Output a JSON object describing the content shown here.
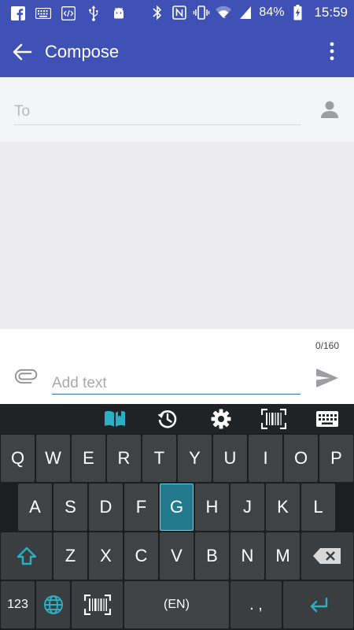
{
  "status_bar": {
    "battery": "84%",
    "time": "15:59",
    "left_icons": [
      "facebook-icon",
      "keyboard-icon",
      "code-icon",
      "usb-icon",
      "android-icon"
    ],
    "right_icons": [
      "bluetooth-icon",
      "nfc-icon",
      "vibrate-icon",
      "wifi-icon",
      "signal-icon",
      "battery-charging-icon"
    ]
  },
  "app_bar": {
    "title": "Compose"
  },
  "recipient": {
    "placeholder": "To"
  },
  "composer": {
    "counter": "0/160",
    "placeholder": "Add text"
  },
  "keyboard_toolbar": [
    "dictionary-icon",
    "history-icon",
    "settings-icon",
    "barcode-scan-icon",
    "keyboard-icon"
  ],
  "keyboard": {
    "row1": [
      "Q",
      "W",
      "E",
      "R",
      "T",
      "Y",
      "U",
      "I",
      "O",
      "P"
    ],
    "row2": [
      "A",
      "S",
      "D",
      "F",
      "G",
      "H",
      "J",
      "K",
      "L"
    ],
    "row3": [
      "Z",
      "X",
      "C",
      "V",
      "B",
      "N",
      "M"
    ],
    "active_key": "G",
    "numbers_label": "123",
    "space_label": "(EN)",
    "punctuation_label": ". ,",
    "accent_color": "#2ab0c5"
  },
  "colors": {
    "primary": "#3f51b5",
    "input_underline": "#2a7d8c"
  }
}
